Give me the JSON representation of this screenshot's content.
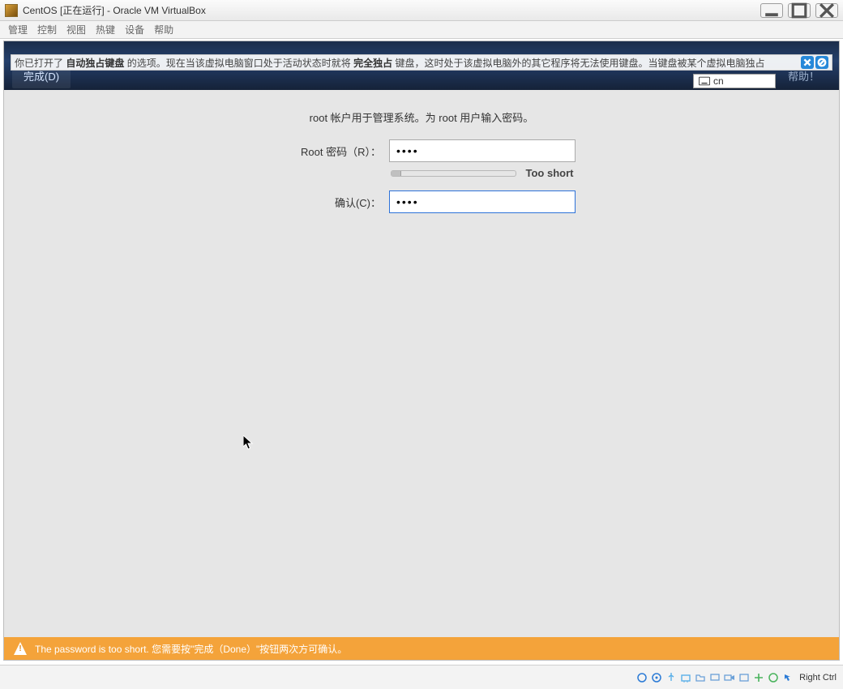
{
  "window": {
    "title": "CentOS [正在运行] - Oracle VM VirtualBox"
  },
  "menubar": {
    "items": [
      "管理",
      "控制",
      "视图",
      "热键",
      "设备",
      "帮助"
    ]
  },
  "keyboard_capture_msg": {
    "prefix": "你已打开了",
    "bold1": "自动独占键盘",
    "mid": "的选项。现在当该虚拟电脑窗口处于活动状态时就将",
    "bold2": "完全独占",
    "suffix": "键盘，这时处于该虚拟电脑外的其它程序将无法使用键盘。当键盘被某个虚拟电脑独占"
  },
  "header": {
    "done_btn": "完成(D)",
    "help_btn": "帮助！",
    "lang": "cn"
  },
  "form": {
    "instruction": "root 帐户用于管理系统。为 root 用户输入密码。",
    "root_pw_label": "Root 密码（R）：",
    "root_pw_value": "••••",
    "strength_text": "Too short",
    "confirm_label": "确认(C)：",
    "confirm_value": "••••"
  },
  "warning": {
    "text": "The password is too short. 您需要按\"完成（Done）\"按钮两次方可确认。"
  },
  "statusbar": {
    "host_key": "Right Ctrl"
  }
}
